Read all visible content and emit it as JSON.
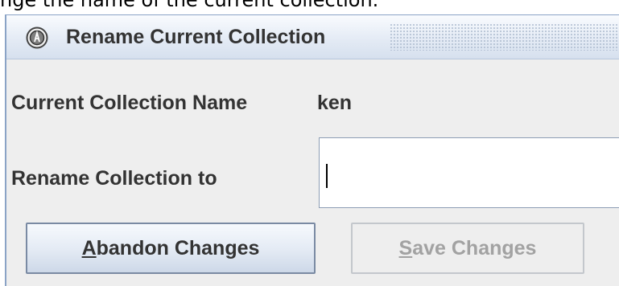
{
  "document": {
    "instruction_text": "nge the name of the current collection."
  },
  "dialog": {
    "title": "Rename Current Collection",
    "current_name_label": "Current Collection Name",
    "current_name_value": "ken",
    "rename_label": "Rename Collection to",
    "rename_input_value": "",
    "abandon_button": {
      "mnemonic": "A",
      "rest": "bandon Changes"
    },
    "save_button": {
      "mnemonic": "S",
      "rest": "ave Changes",
      "enabled": false
    }
  },
  "colors": {
    "dialog_background": "#eeeeee",
    "titlebar_top": "#f9fbfe",
    "titlebar_bottom": "#d6e0ee",
    "border_accent": "#8aa3c6",
    "text": "#333333",
    "disabled_text": "#a2a2a2"
  },
  "icons": {
    "title_icon": "app-logo-icon"
  }
}
